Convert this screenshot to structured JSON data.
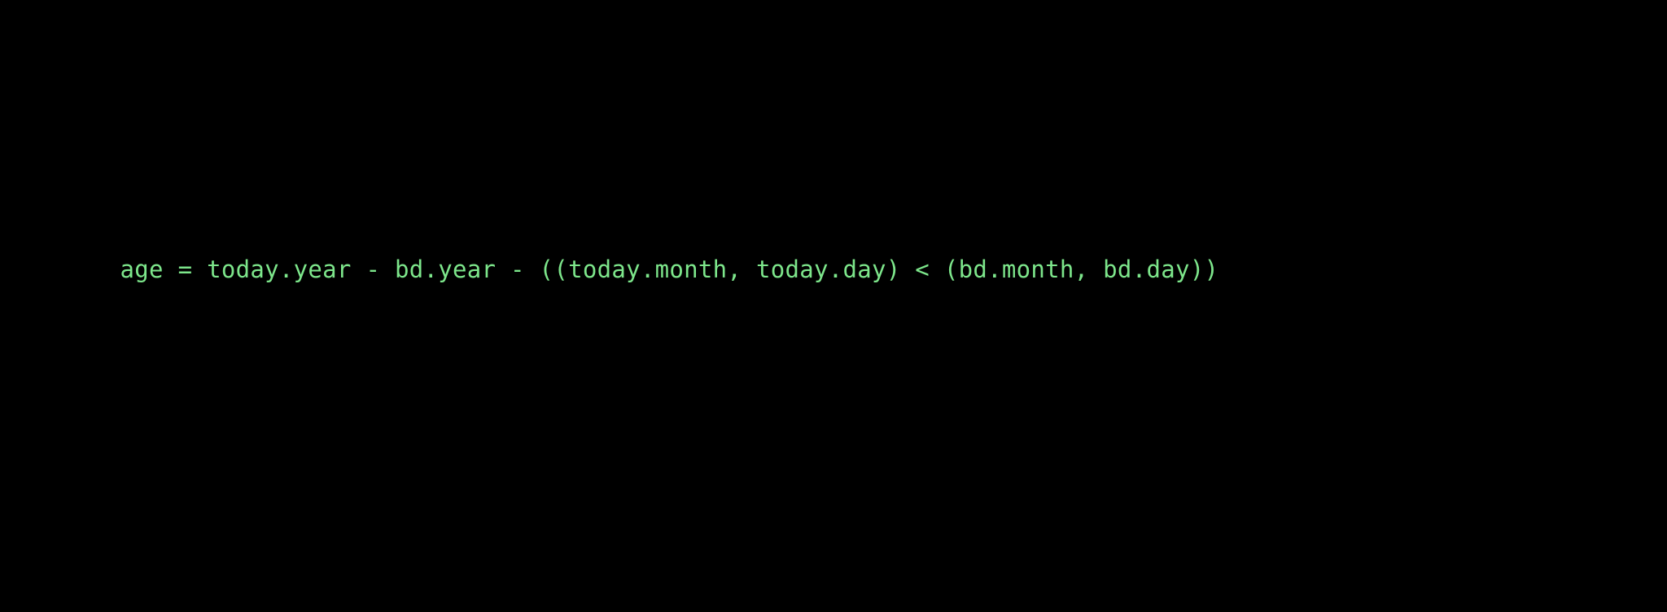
{
  "code": {
    "line1": "age = today.year - bd.year - ((today.month, today.day) < (bd.month, bd.day))"
  }
}
